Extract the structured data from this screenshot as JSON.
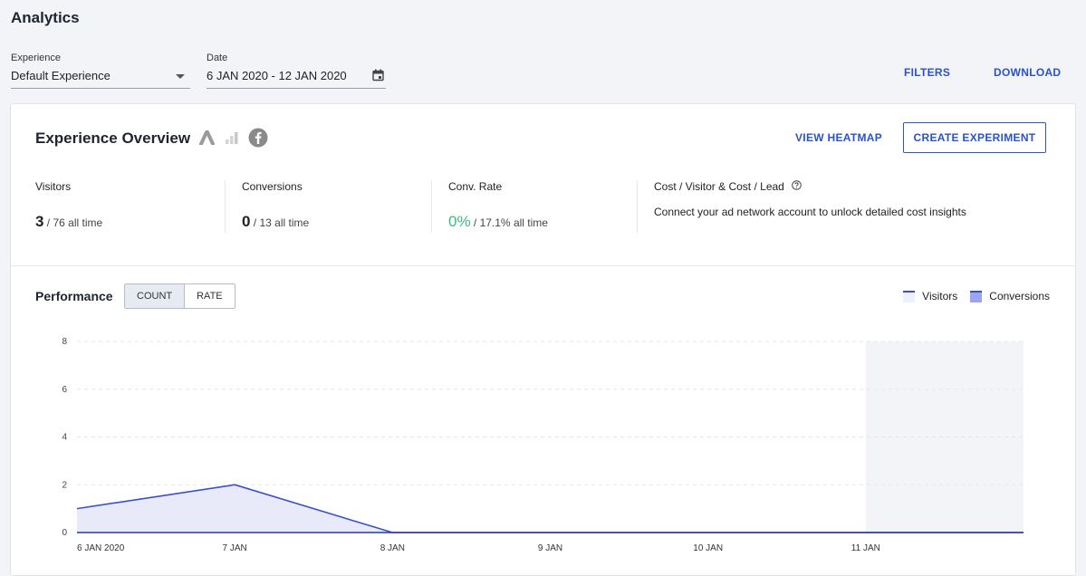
{
  "page": {
    "title": "Analytics"
  },
  "filters": {
    "experience_label": "Experience",
    "experience_value": "Default Experience",
    "date_label": "Date",
    "date_value": "6 JAN 2020 - 12 JAN 2020",
    "filters_link": "FILTERS",
    "download_link": "DOWNLOAD"
  },
  "overview": {
    "title": "Experience Overview",
    "view_heatmap": "VIEW HEATMAP",
    "create_experiment": "CREATE EXPERIMENT",
    "stats": [
      {
        "label": "Visitors",
        "value": "3",
        "alltime": " / 76 all time"
      },
      {
        "label": "Conversions",
        "value": "0",
        "alltime": " / 13 all time"
      },
      {
        "label": "Conv. Rate",
        "value": "0%",
        "alltime": " / 17.1% all time"
      }
    ],
    "cost": {
      "label": "Cost / Visitor & Cost / Lead",
      "desc": "Connect your ad network account to unlock detailed cost insights"
    }
  },
  "performance": {
    "title": "Performance",
    "toggle": [
      "COUNT",
      "RATE"
    ],
    "active_toggle": "COUNT",
    "legend": [
      "Visitors",
      "Conversions"
    ]
  },
  "colors": {
    "accent": "#2a52c9",
    "green": "#3dbb7b",
    "visitors_line": "#3a4fc9",
    "visitors_fill": "#e8eaf9",
    "conversions_fill": "#9aa6ef"
  },
  "chart_data": {
    "type": "area",
    "x": [
      "6 JAN 2020",
      "7 JAN",
      "8 JAN",
      "9 JAN",
      "10 JAN",
      "11 JAN",
      "12 JAN"
    ],
    "tick_labels": [
      "6 JAN 2020",
      "7 JAN",
      "8 JAN",
      "9 JAN",
      "10 JAN",
      "11 JAN"
    ],
    "series": [
      {
        "name": "Visitors",
        "values": [
          1,
          2,
          0,
          0,
          0,
          0,
          0
        ]
      },
      {
        "name": "Conversions",
        "values": [
          0,
          0,
          0,
          0,
          0,
          0,
          0
        ]
      }
    ],
    "ylim": [
      0,
      8
    ],
    "yticks": [
      0,
      2,
      4,
      6,
      8
    ],
    "grid": true,
    "highlight_range": [
      "11 JAN",
      "12 JAN"
    ],
    "legend_position": "top-right"
  }
}
